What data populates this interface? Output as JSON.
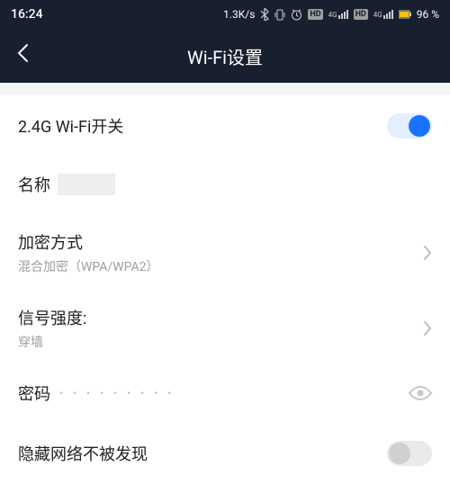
{
  "status": {
    "time": "16:24",
    "speed": "1.3K/s",
    "net_label": "4G",
    "battery": "96 %"
  },
  "header": {
    "title": "Wi-Fi设置"
  },
  "wifi": {
    "switch_label": "2.4G Wi-Fi开关",
    "name_label": "名称",
    "name_value": "",
    "encryption_label": "加密方式",
    "encryption_value": "混合加密（WPA/WPA2）",
    "signal_label": "信号强度:",
    "signal_value": "穿墙",
    "password_label": "密码",
    "password_mask": "• • • • • • • • •",
    "hide_label": "隐藏网络不被发现"
  }
}
